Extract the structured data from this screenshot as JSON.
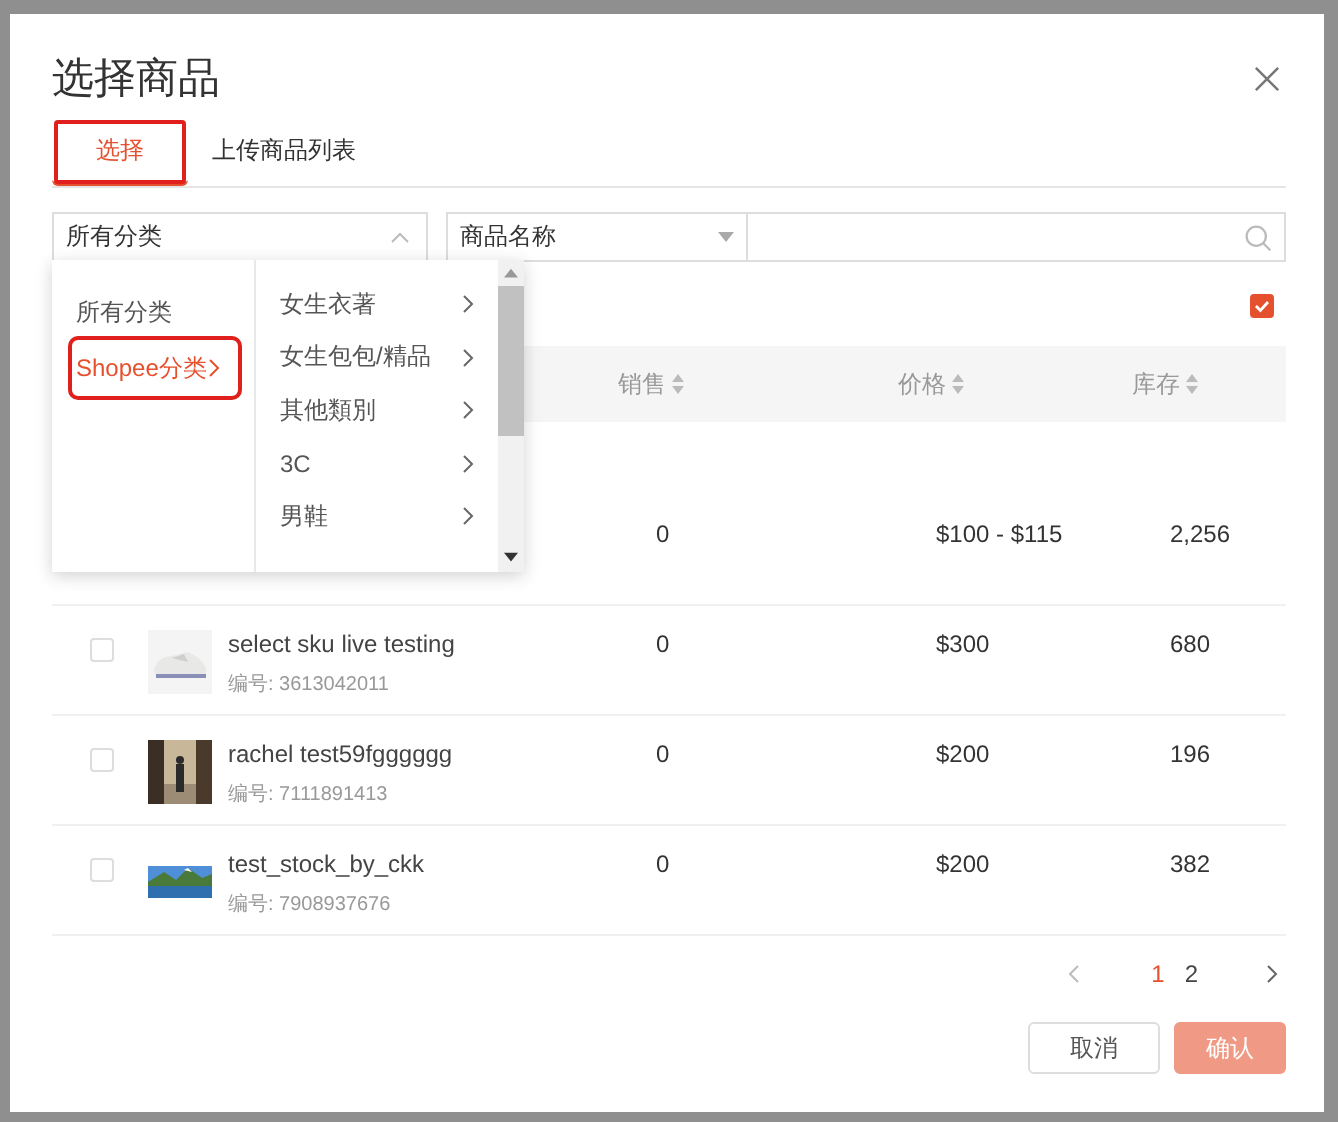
{
  "dialog": {
    "title": "选择商品"
  },
  "tabs": [
    {
      "label": "选择",
      "selected": true,
      "annotated": true
    },
    {
      "label": "上传商品列表",
      "selected": false,
      "annotated": false
    }
  ],
  "category_select": {
    "value": "所有分类",
    "expanded": true
  },
  "search": {
    "field_select": "商品名称"
  },
  "cascader": {
    "level_1": [
      {
        "label": "所有分类",
        "selected": false,
        "annotated": false,
        "has_children": false
      },
      {
        "label": "Shopee分类",
        "selected": true,
        "annotated": true,
        "has_children": true
      }
    ],
    "level_2": [
      {
        "label": "女生衣著"
      },
      {
        "label": "女生包包/精品"
      },
      {
        "label": "其他類別"
      },
      {
        "label": "3C"
      },
      {
        "label": "男鞋"
      }
    ]
  },
  "select_all": {
    "checked": true
  },
  "table": {
    "columns": [
      {
        "label": "销售",
        "sortable": true
      },
      {
        "label": "价格",
        "sortable": true
      },
      {
        "label": "库存",
        "sortable": true
      }
    ],
    "rows": [
      {
        "sales": "0",
        "price": "$100 - $115",
        "stock": "2,256"
      },
      {
        "checked": false,
        "name": "select sku live testing",
        "code": "编号: 3613042011",
        "sales": "0",
        "price": "$300",
        "stock": "680"
      },
      {
        "checked": false,
        "name": "rachel test59fgggggg",
        "code": "编号: 7111891413",
        "sales": "0",
        "price": "$200",
        "stock": "196"
      },
      {
        "checked": false,
        "name": "test_stock_by_ckk",
        "code": "编号: 7908937676",
        "sales": "0",
        "price": "$200",
        "stock": "382"
      }
    ]
  },
  "pagination": {
    "pages": [
      {
        "label": "1",
        "selected": true
      },
      {
        "label": "2",
        "selected": false
      }
    ]
  },
  "buttons": [
    {
      "label": "取消",
      "kind": "secondary"
    },
    {
      "label": "确认",
      "kind": "primary"
    }
  ]
}
